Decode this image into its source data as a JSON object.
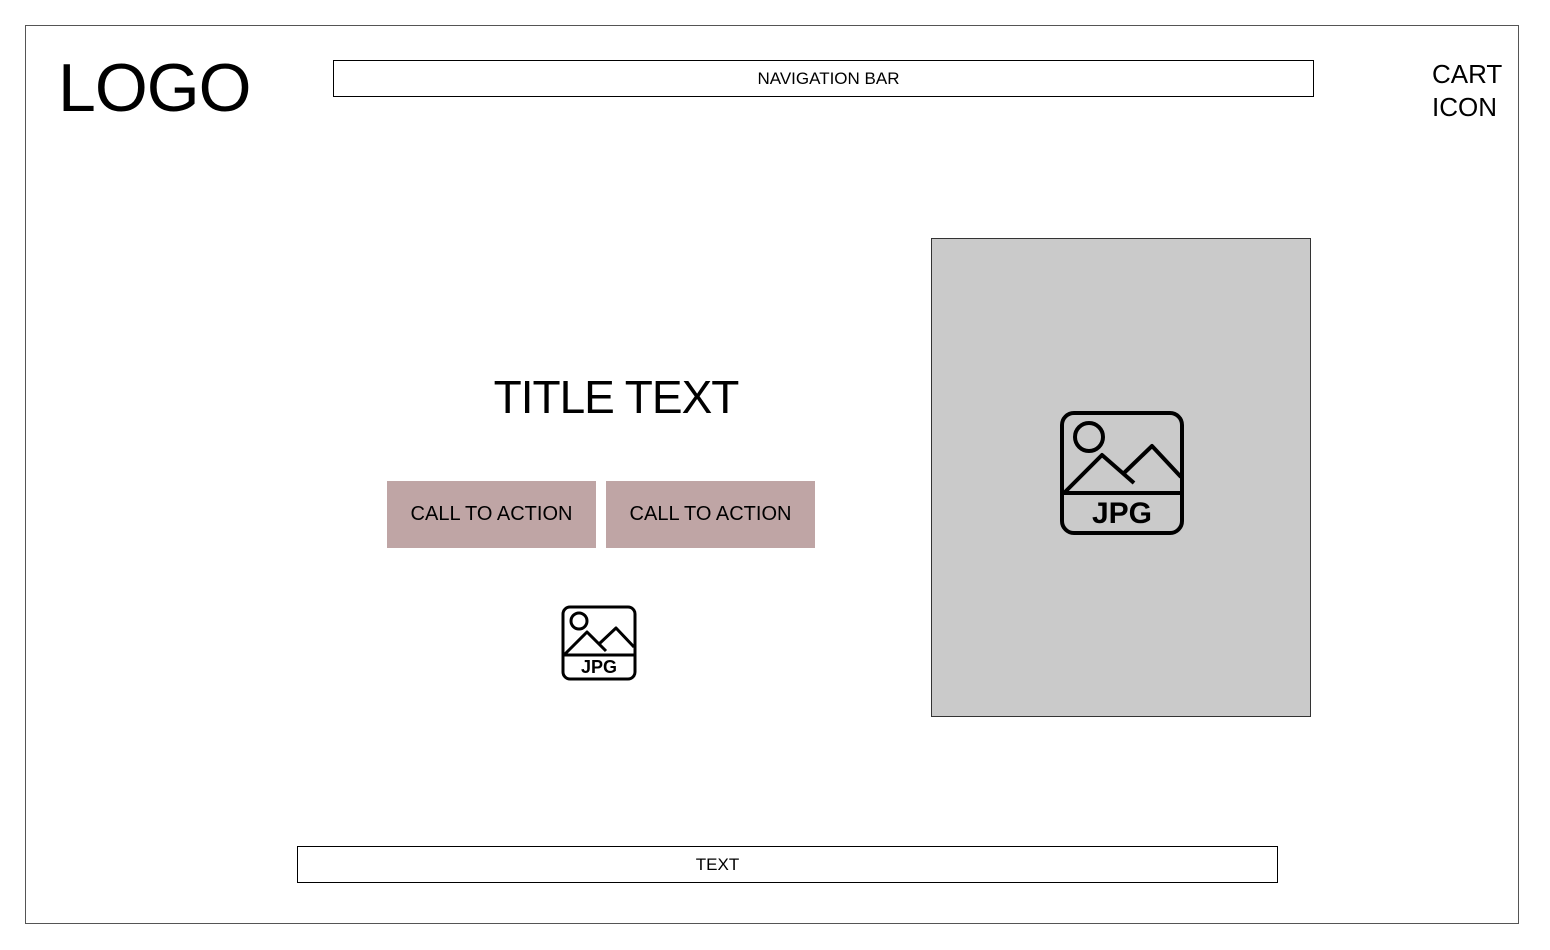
{
  "header": {
    "logo_text": "LOGO",
    "nav_label": "NAVIGATION BAR",
    "cart_line1": "CART",
    "cart_line2": "ICON"
  },
  "hero": {
    "title": "TITLE TEXT",
    "cta_primary": "CALL TO ACTION",
    "cta_secondary": "CALL TO ACTION",
    "small_image_icon": "jpg-image-icon",
    "small_image_label": "JPG",
    "large_image_icon": "jpg-image-icon",
    "large_image_label": "JPG"
  },
  "footer": {
    "text": "TEXT"
  },
  "colors": {
    "cta_background": "#bfa5a5",
    "image_placeholder": "#cacaca",
    "border": "#555555"
  }
}
